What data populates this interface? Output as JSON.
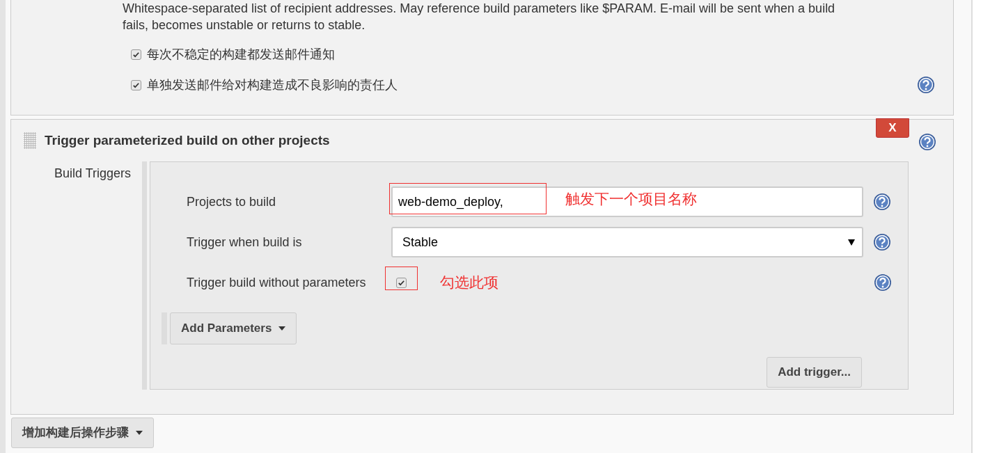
{
  "email_section": {
    "description_lines": [
      "Whitespace-separated list of recipient addresses. May reference build parameters like $PARAM. E-mail will be sent when a build",
      "fails, becomes unstable or returns to stable."
    ],
    "options": [
      {
        "label": "每次不稳定的构建都发送邮件通知",
        "checked": true
      },
      {
        "label": "单独发送邮件给对构建造成不良影响的责任人",
        "checked": true
      }
    ]
  },
  "trigger_section": {
    "title": "Trigger parameterized build on other projects",
    "delete_button": "X",
    "group_label": "Build Triggers",
    "fields": [
      {
        "kind": "text",
        "label": "Projects to build",
        "value": "web-demo_deploy,"
      },
      {
        "kind": "select",
        "label": "Trigger when build is",
        "value": "Stable"
      },
      {
        "kind": "checkbox",
        "label": "Trigger build without parameters",
        "checked": true
      }
    ],
    "add_parameters_button": "Add Parameters",
    "add_trigger_button": "Add trigger..."
  },
  "annotations": [
    {
      "text": "触发下一个项目名称"
    },
    {
      "text": "勾选此项"
    }
  ],
  "add_post_build_button": "增加构建后操作步骤"
}
